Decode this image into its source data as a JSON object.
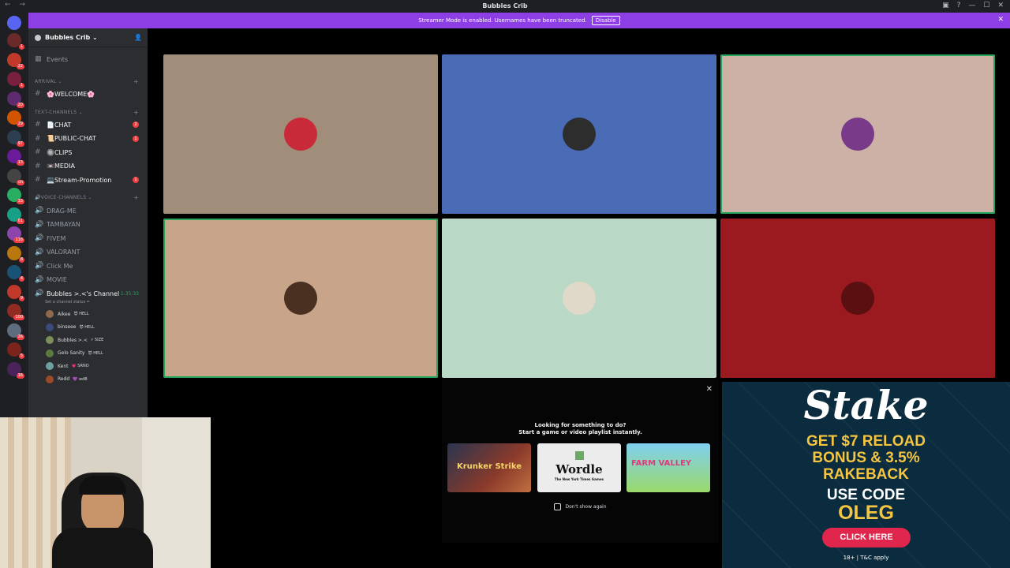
{
  "window": {
    "title": "Bubbles Crib",
    "nav": "← →"
  },
  "banner": {
    "text": "Streamer Mode is enabled. Usernames have been truncated.",
    "button": "Disable"
  },
  "server_list": [
    {
      "badge": "1",
      "color": "#6b2a2a"
    },
    {
      "badge": "22",
      "color": "#c0392b"
    },
    {
      "badge": "1",
      "color": "#7a1f3d"
    },
    {
      "badge": "20",
      "color": "#5e2b6e"
    },
    {
      "badge": "29",
      "color": "#d35400"
    },
    {
      "badge": "97",
      "color": "#2c3e50"
    },
    {
      "badge": "13",
      "color": "#6a1b9a"
    },
    {
      "badge": "ch",
      "color": "#444"
    },
    {
      "badge": "33",
      "color": "#27ae60"
    },
    {
      "badge": "61",
      "color": "#16a085"
    },
    {
      "badge": "116",
      "color": "#8e44ad"
    },
    {
      "badge": "8",
      "color": "#b9770e"
    },
    {
      "badge": "4",
      "color": "#1a5276"
    },
    {
      "badge": "9",
      "color": "#c0392b"
    },
    {
      "badge": "100",
      "color": "#922b21"
    },
    {
      "badge": "26",
      "color": "#5d6d7e"
    },
    {
      "badge": "5",
      "color": "#7b241c"
    },
    {
      "badge": "16",
      "color": "#4a235a"
    }
  ],
  "guild": {
    "name": "Bubbles Crib"
  },
  "sidebar": {
    "events": "Events",
    "categories": {
      "arrival": "ARRIVAL",
      "text": "TEXT-CHANNELS",
      "voice": "VOICE-CHANNELS"
    },
    "welcome": "🌸WELCOME🌸",
    "text_channels": [
      {
        "name": "📄CHAT",
        "count": "2"
      },
      {
        "name": "📜PUBLIC-CHAT",
        "count": "1"
      },
      {
        "name": "🔘CLIPS",
        "count": ""
      },
      {
        "name": "📼MEDIA",
        "count": ""
      },
      {
        "name": "💻Stream-Promotion",
        "count": "1"
      }
    ],
    "voice_channels": [
      "DRAG-ME",
      "TAMBAYAN",
      "FIVEM",
      "VALORANT",
      "Click Me",
      "MOVIE"
    ],
    "active_channel": {
      "name": "Bubbles >.<'s Channel",
      "timer": "1:35:33",
      "status": "Set a channel status ✏"
    },
    "users": [
      {
        "name": "Aikee",
        "tag": "😈 HELL",
        "color": "#8e6b4e"
      },
      {
        "name": "binseee",
        "tag": "😈 HELL",
        "color": "#3b4a7a"
      },
      {
        "name": "Bubbles >.<",
        "tag": "⚡ 5IZE",
        "color": "#7b8f5a"
      },
      {
        "name": "Gelo Sanity",
        "tag": "😈 HELL",
        "color": "#5d7a3a"
      },
      {
        "name": "Kent",
        "tag": "💗 SRNO",
        "color": "#6fa0a0"
      },
      {
        "name": "Redd",
        "tag": "💜 wdB",
        "color": "#9a4a2a"
      }
    ]
  },
  "video_tiles": [
    {
      "bg": "#a08d7a",
      "avatar": "#c92a3a",
      "speaking": false
    },
    {
      "bg": "#4a6bb5",
      "avatar": "#2d2d2d",
      "speaking": false
    },
    {
      "bg": "#cdb1a6",
      "avatar": "#7a3a8a",
      "speaking": true
    },
    {
      "bg": "#c8a58a",
      "avatar": "#4a3020",
      "speaking": true
    },
    {
      "bg": "#b9d8c5",
      "avatar": "#e0d8c8",
      "speaking": false
    },
    {
      "bg": "#9a1a20",
      "avatar": "#5a1010",
      "speaking": false
    }
  ],
  "activity_prompt": {
    "line1": "Looking for something to do?",
    "line2": "Start a game or video playlist instantly.",
    "cards": [
      {
        "label": "Krunker Strike",
        "bg": "#3a4a6a"
      },
      {
        "label": "Wordle",
        "sub": "The New York Times Games",
        "bg": "#ececec"
      },
      {
        "label": "FARM VALLEY",
        "bg": "#6cc4e8"
      }
    ],
    "dont_show": "Don't show again"
  },
  "ad": {
    "brand": "Stake",
    "offer_lines": [
      "GET $7 RELOAD",
      "BONUS & 3.5%",
      "RAKEBACK"
    ],
    "code_label": "USE CODE",
    "code": "OLEG",
    "cta": "CLICK HERE",
    "terms": "18+ | T&C apply"
  }
}
